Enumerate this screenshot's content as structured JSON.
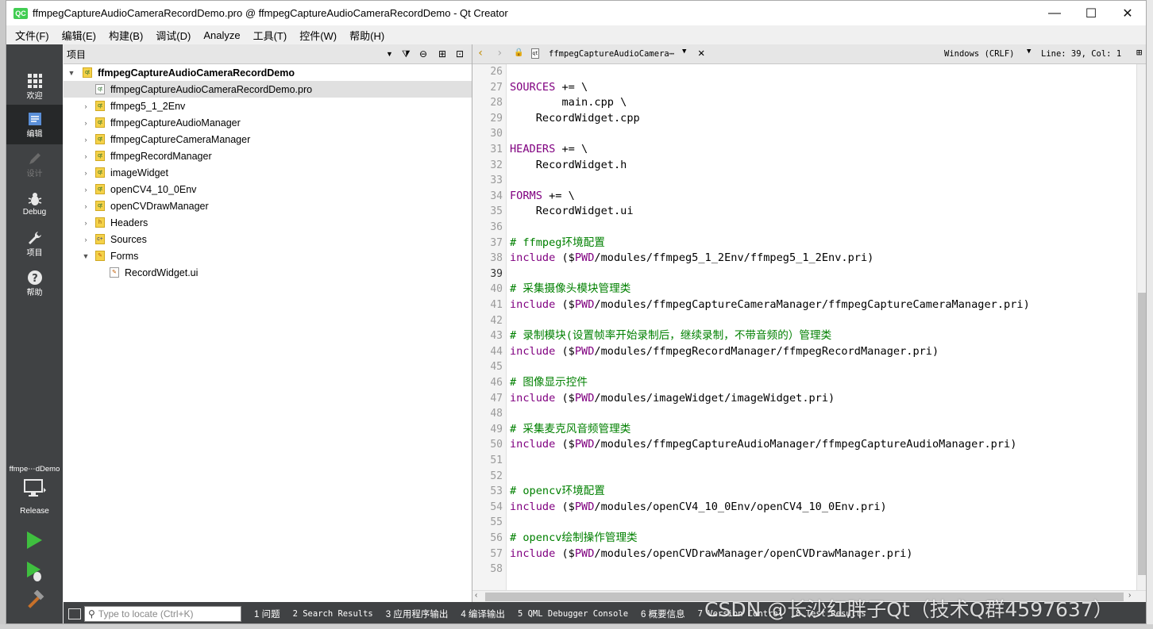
{
  "window": {
    "logo": "QC",
    "title": "ffmpegCaptureAudioCameraRecordDemo.pro @ ffmpegCaptureAudioCameraRecordDemo - Qt Creator",
    "minimize": "—",
    "maximize": "☐",
    "close": "✕"
  },
  "menu": [
    "文件(F)",
    "编辑(E)",
    "构建(B)",
    "调试(D)",
    "Analyze",
    "工具(T)",
    "控件(W)",
    "帮助(H)"
  ],
  "sidebar": {
    "modes": [
      {
        "label": "欢迎",
        "icon": "grid-icon"
      },
      {
        "label": "编辑",
        "icon": "document-icon"
      },
      {
        "label": "设计",
        "icon": "pencil-icon"
      },
      {
        "label": "Debug",
        "icon": "bug-icon"
      },
      {
        "label": "项目",
        "icon": "wrench-icon"
      },
      {
        "label": "帮助",
        "icon": "help-icon"
      }
    ],
    "target_project": "ffmpe⋯dDemo",
    "build_config": "Release"
  },
  "projects_panel": {
    "title": "项目",
    "tree": [
      {
        "label": "ffmpegCaptureAudioCameraRecordDemo",
        "level": 0,
        "expanded": true,
        "bold": true,
        "type": "project"
      },
      {
        "label": "ffmpegCaptureAudioCameraRecordDemo.pro",
        "level": 1,
        "selected": true,
        "type": "pro"
      },
      {
        "label": "ffmpeg5_1_2Env",
        "level": 1,
        "type": "folder"
      },
      {
        "label": "ffmpegCaptureAudioManager",
        "level": 1,
        "type": "folder"
      },
      {
        "label": "ffmpegCaptureCameraManager",
        "level": 1,
        "type": "folder"
      },
      {
        "label": "ffmpegRecordManager",
        "level": 1,
        "type": "folder"
      },
      {
        "label": "imageWidget",
        "level": 1,
        "type": "folder"
      },
      {
        "label": "openCV4_10_0Env",
        "level": 1,
        "type": "folder"
      },
      {
        "label": "openCVDrawManager",
        "level": 1,
        "type": "folder"
      },
      {
        "label": "Headers",
        "level": 1,
        "type": "headers"
      },
      {
        "label": "Sources",
        "level": 1,
        "type": "sources"
      },
      {
        "label": "Forms",
        "level": 1,
        "expanded": true,
        "type": "forms"
      },
      {
        "label": "RecordWidget.ui",
        "level": 2,
        "type": "ui"
      }
    ]
  },
  "editor_toolbar": {
    "file": "ffmpegCaptureAudioCamera⋯",
    "encoding": "Windows (CRLF)",
    "position": "Line: 39, Col: 1"
  },
  "editor": {
    "current_line": 39,
    "lines": [
      {
        "n": 26,
        "t": ""
      },
      {
        "n": 27,
        "t": "SOURCES += \\"
      },
      {
        "n": 28,
        "t": "        main.cpp \\"
      },
      {
        "n": 29,
        "t": "    RecordWidget.cpp"
      },
      {
        "n": 30,
        "t": ""
      },
      {
        "n": 31,
        "t": "HEADERS += \\"
      },
      {
        "n": 32,
        "t": "    RecordWidget.h"
      },
      {
        "n": 33,
        "t": ""
      },
      {
        "n": 34,
        "t": "FORMS += \\"
      },
      {
        "n": 35,
        "t": "    RecordWidget.ui"
      },
      {
        "n": 36,
        "t": ""
      },
      {
        "n": 37,
        "t": "# ffmpeg环境配置"
      },
      {
        "n": 38,
        "t": "include ($$PWD/modules/ffmpeg5_1_2Env/ffmpeg5_1_2Env.pri)"
      },
      {
        "n": 39,
        "t": ""
      },
      {
        "n": 40,
        "t": "# 采集摄像头模块管理类"
      },
      {
        "n": 41,
        "t": "include ($$PWD/modules/ffmpegCaptureCameraManager/ffmpegCaptureCameraManager.pri)"
      },
      {
        "n": 42,
        "t": ""
      },
      {
        "n": 43,
        "t": "# 录制模块(设置帧率开始录制后，继续录制，不带音频的）管理类"
      },
      {
        "n": 44,
        "t": "include ($$PWD/modules/ffmpegRecordManager/ffmpegRecordManager.pri)"
      },
      {
        "n": 45,
        "t": ""
      },
      {
        "n": 46,
        "t": "# 图像显示控件"
      },
      {
        "n": 47,
        "t": "include ($$PWD/modules/imageWidget/imageWidget.pri)"
      },
      {
        "n": 48,
        "t": ""
      },
      {
        "n": 49,
        "t": "# 采集麦克风音频管理类"
      },
      {
        "n": 50,
        "t": "include ($$PWD/modules/ffmpegCaptureAudioManager/ffmpegCaptureAudioManager.pri)"
      },
      {
        "n": 51,
        "t": ""
      },
      {
        "n": 52,
        "t": ""
      },
      {
        "n": 53,
        "t": "# opencv环境配置"
      },
      {
        "n": 54,
        "t": "include ($$PWD/modules/openCV4_10_0Env/openCV4_10_0Env.pri)"
      },
      {
        "n": 55,
        "t": ""
      },
      {
        "n": 56,
        "t": "# opencv绘制操作管理类"
      },
      {
        "n": 57,
        "t": "include ($$PWD/modules/openCVDrawManager/openCVDrawManager.pri)"
      },
      {
        "n": 58,
        "t": ""
      }
    ]
  },
  "statusbar": {
    "locate_placeholder": "Type to locate (Ctrl+K)",
    "panes": [
      "1 问题",
      "2 Search Results",
      "3 应用程序输出",
      "4 编译输出",
      "5 QML Debugger Console",
      "6 概要信息",
      "7 Version Control",
      "8 Test Results"
    ]
  },
  "watermark": "CSDN @长沙红胖子Qt（技术Q群4597637）"
}
